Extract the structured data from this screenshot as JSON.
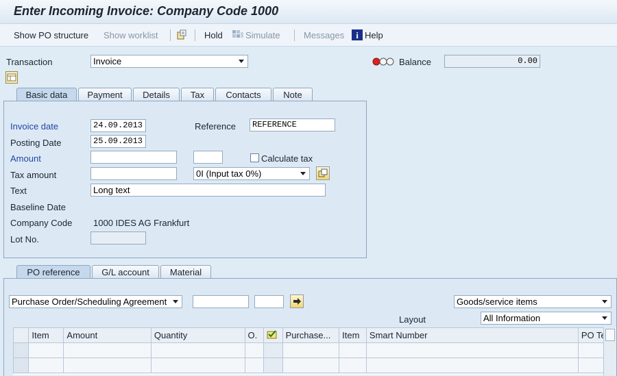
{
  "title": "Enter Incoming Invoice: Company Code 1000",
  "toolbar": {
    "show_po_structure": "Show PO structure",
    "show_worklist": "Show worklist",
    "hold": "Hold",
    "simulate": "Simulate",
    "messages": "Messages",
    "help": "Help"
  },
  "header": {
    "transaction_label": "Transaction",
    "transaction_value": "Invoice",
    "balance_label": "Balance",
    "balance_value": "0.00"
  },
  "tabs": [
    "Basic data",
    "Payment",
    "Details",
    "Tax",
    "Contacts",
    "Note"
  ],
  "basic": {
    "invoice_date_label": "Invoice date",
    "invoice_date": "24.09.2013",
    "reference_label": "Reference",
    "reference": "REFERENCE",
    "posting_date_label": "Posting Date",
    "posting_date": "25.09.2013",
    "amount_label": "Amount",
    "amount": "",
    "currency": "",
    "calculate_tax_label": "Calculate tax",
    "tax_amount_label": "Tax amount",
    "tax_amount": "",
    "tax_code": "0I (Input tax 0%)",
    "text_label": "Text",
    "text": "Long text",
    "baseline_date_label": "Baseline Date",
    "company_code_label": "Company Code",
    "company_code": "1000 IDES AG Frankfurt",
    "lot_no_label": "Lot No."
  },
  "bottom_tabs": [
    "PO reference",
    "G/L account",
    "Material"
  ],
  "po_ref": {
    "reference_type": "Purchase Order/Scheduling Agreement",
    "po_number": "",
    "po_item": "",
    "items_select": "Goods/service items",
    "layout_label": "Layout",
    "layout_value": "All Information"
  },
  "grid": {
    "columns": [
      "Item",
      "Amount",
      "Quantity",
      "O.",
      "",
      "Purchase...",
      "Item",
      "Smart Number",
      "PO Tex"
    ]
  },
  "colors": {
    "accent_blue": "#2146a3",
    "background": "#dfebf5",
    "traffic_red": "#e0201b"
  }
}
